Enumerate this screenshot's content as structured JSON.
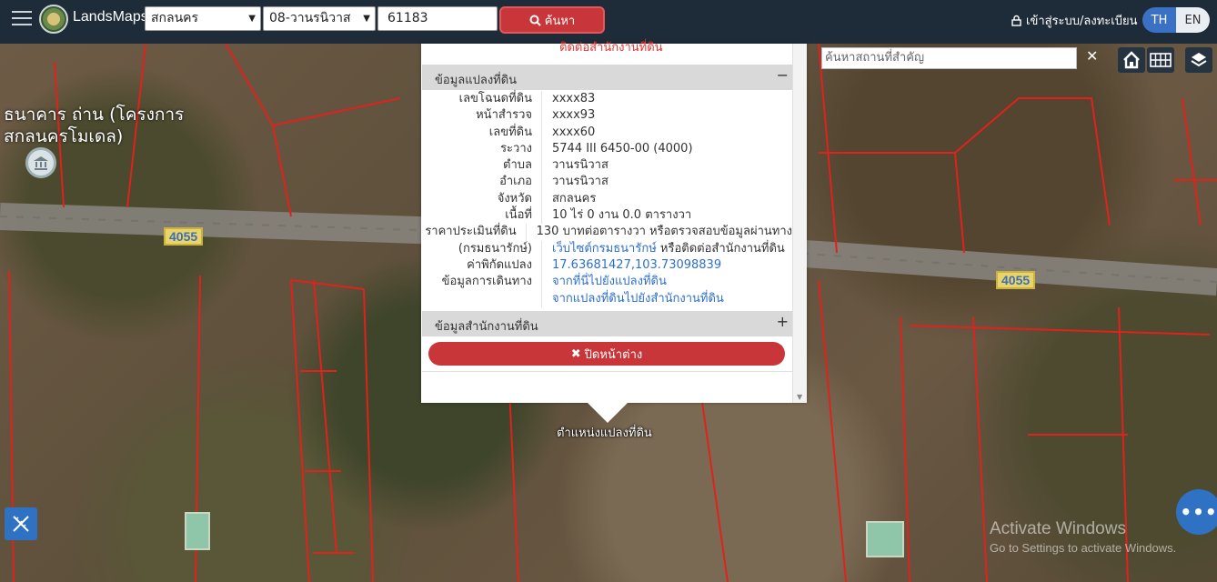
{
  "header": {
    "brand": "LandsMaps",
    "province_select": "สกลนคร",
    "district_select": "08-วานรนิวาส",
    "parcel_input": "61183",
    "search_label": "ค้นหา",
    "login_label": "เข้าสู่ระบบ/ลงทะเบียน",
    "lang_th": "TH",
    "lang_en": "EN"
  },
  "map": {
    "place_search_placeholder": "ค้นหาสถานที่สำคัญ",
    "road_label_1": "4055",
    "road_label_2": "4055",
    "bank_label_line1": "ธนาคาร ถ่าน (โครงการ",
    "bank_label_line2": "สกลนครโมเดล)",
    "marker_label": "ตำแหน่งแปลงที่ดิน",
    "activate_line1": "Activate Windows",
    "activate_line2": "Go to Settings to activate Windows."
  },
  "popup": {
    "top_cut_text": "ติดต่อสำนักงานที่ดิน",
    "section_parcel": "ข้อมูลแปลงที่ดิน",
    "section_office": "ข้อมูลสำนักงานที่ดิน",
    "rows": [
      {
        "label": "เลขโฉนดที่ดิน",
        "value": "xxxx83"
      },
      {
        "label": "หน้าสำรวจ",
        "value": "xxxx93"
      },
      {
        "label": "เลขที่ดิน",
        "value": "xxxx60"
      },
      {
        "label": "ระวาง",
        "value": "5744 III 6450-00 (4000)"
      },
      {
        "label": "ตำบล",
        "value": "วานรนิวาส"
      },
      {
        "label": "อำเภอ",
        "value": "วานรนิวาส"
      },
      {
        "label": "จังหวัด",
        "value": "สกลนคร"
      },
      {
        "label": "เนื้อที่",
        "value": "10 ไร่ 0 งาน 0.0 ตารางวา"
      },
      {
        "label": "ราคาประเมินที่ดิน",
        "value": "130 บาทต่อตารางวา หรือตรวจสอบข้อมูลผ่านทาง"
      },
      {
        "label": "(กรมธนารักษ์)",
        "link": "เว็บไซต์กรมธนารักษ์",
        "value": " หรือติดต่อสำนักงานที่ดิน"
      },
      {
        "label": "ค่าพิกัดแปลง",
        "link": "17.63681427,103.73098839"
      },
      {
        "label": "ข้อมูลการเดินทาง",
        "link": "จากที่นี่ไปยังแปลงที่ดิน"
      },
      {
        "label": "",
        "link": "จากแปลงที่ดินไปยังสำนักงานที่ดิน"
      }
    ],
    "close_label": "ปิดหน้าต่าง"
  }
}
